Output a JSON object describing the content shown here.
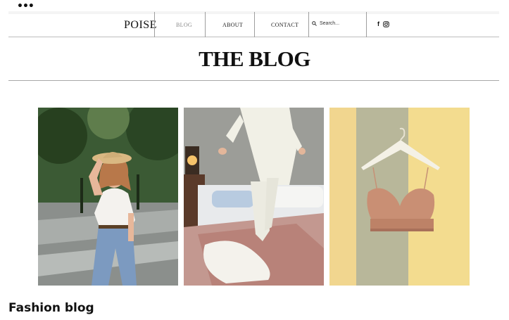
{
  "toolbar": {
    "more_icon": "more-horizontal-icon",
    "more_glyph": "•••"
  },
  "header": {
    "logo": "POISE",
    "nav": [
      {
        "label": "BLOG",
        "active": true
      },
      {
        "label": "ABOUT",
        "active": false
      },
      {
        "label": "CONTACT",
        "active": false
      }
    ],
    "search": {
      "placeholder": "Search...",
      "icon": "search-icon"
    },
    "social": [
      {
        "name": "facebook-icon",
        "glyph": "f"
      },
      {
        "name": "instagram-icon"
      }
    ]
  },
  "main": {
    "title": "THE BLOG",
    "posts": [
      {
        "image": "woman-in-straw-hat-white-tee-jeans"
      },
      {
        "image": "person-in-pajamas-on-bed"
      },
      {
        "image": "bralette-on-hanger"
      }
    ],
    "caption": "Fashion blog"
  },
  "colors": {
    "text": "#111111",
    "divider": "#bdbdbd",
    "active_nav": "#888888"
  }
}
